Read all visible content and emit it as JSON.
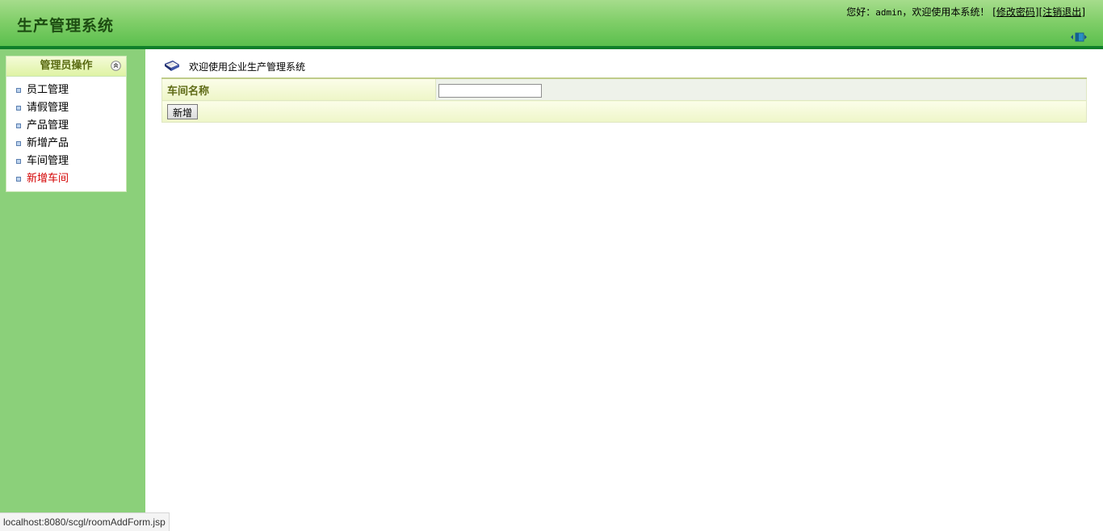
{
  "header": {
    "app_title": "生产管理系统",
    "greeting_prefix": "您好：",
    "username": "admin",
    "greeting_suffix": "，欢迎使用本系统！",
    "change_password_label": "修改密码",
    "logout_label": "注销退出",
    "bracket_open": "[",
    "bracket_close": "]",
    "toggle_icon": "sidebar-toggle-icon"
  },
  "sidebar": {
    "panel_title": "管理员操作",
    "collapse_icon": "collapse-up-icon",
    "items": [
      {
        "label": "员工管理",
        "active": false
      },
      {
        "label": "请假管理",
        "active": false
      },
      {
        "label": "产品管理",
        "active": false
      },
      {
        "label": "新增产品",
        "active": false
      },
      {
        "label": "车间管理",
        "active": false
      },
      {
        "label": "新增车间",
        "active": true
      }
    ]
  },
  "main": {
    "welcome_text": "欢迎使用企业生产管理系统",
    "form": {
      "field_label": "车间名称",
      "field_value": "",
      "submit_label": "新增"
    }
  },
  "status_bar": {
    "url": "localhost:8080/scgl/roomAddForm.jsp"
  },
  "colors": {
    "header_green": "#5bbf4d",
    "sidebar_green": "#8bd07a",
    "active_item": "#d40000",
    "header_bar": "#0f7f2a"
  }
}
